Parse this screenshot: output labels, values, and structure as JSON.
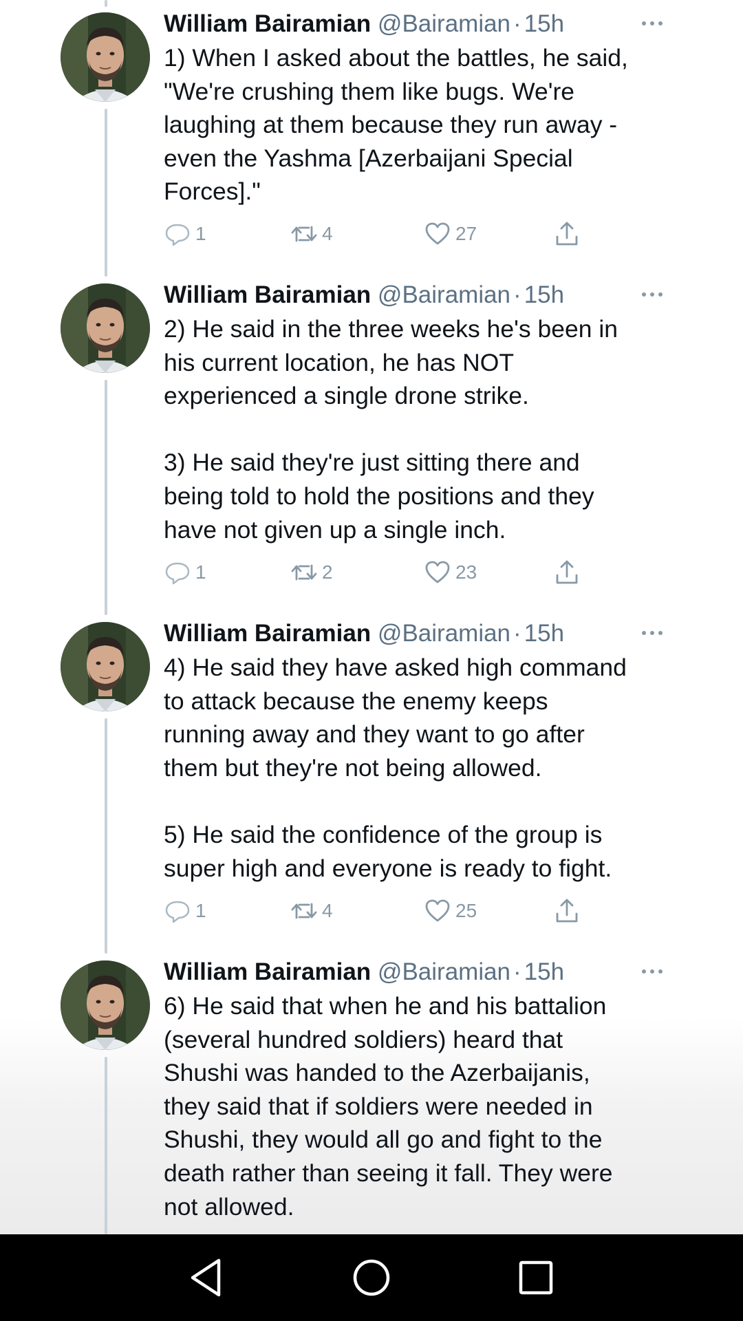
{
  "colors": {
    "text": "#0f1419",
    "secondary": "#5b7083",
    "action_gray": "#8899a6",
    "thread_line": "#c9d1d8",
    "nav_bg": "#000000"
  },
  "tweets": [
    {
      "author": "William Bairamian",
      "handle": "@Bairamian",
      "separator": "·",
      "time": "15h",
      "text": "1) When I asked about the battles, he said,\n\"We're crushing them like bugs. We're\nlaughing at them because they run away -\neven the Yashma [Azerbaijani Special\nForces].\"",
      "replies": "1",
      "retweets": "4",
      "likes": "27"
    },
    {
      "author": "William Bairamian",
      "handle": "@Bairamian",
      "separator": "·",
      "time": "15h",
      "text": "2) He said in the three weeks he's been in\nhis current location, he has NOT\nexperienced a single drone strike.\n\n3) He said they're just sitting there and\nbeing told to hold the positions and they\nhave not given up a single inch.",
      "replies": "1",
      "retweets": "2",
      "likes": "23"
    },
    {
      "author": "William Bairamian",
      "handle": "@Bairamian",
      "separator": "·",
      "time": "15h",
      "text": "4) He said they have asked high command\nto attack because the enemy keeps\nrunning away and they want to go after\nthem but they're not being allowed.\n\n5) He said the confidence of the group is\nsuper high and everyone is ready to fight.",
      "replies": "1",
      "retweets": "4",
      "likes": "25"
    },
    {
      "author": "William Bairamian",
      "handle": "@Bairamian",
      "separator": "·",
      "time": "15h",
      "text": "6) He said that when he and his battalion\n(several hundred soldiers) heard that\nShushi was handed to the Azerbaijanis,\nthey said that if soldiers were needed in\nShushi, they would all go and fight to the\ndeath rather than seeing it fall. They were\nnot allowed."
    }
  ],
  "icons": {
    "more": "more-options-icon",
    "reply": "reply-icon",
    "retweet": "retweet-icon",
    "like": "heart-icon",
    "share": "share-icon",
    "nav_back": "back-triangle-icon",
    "nav_home": "home-circle-icon",
    "nav_recents": "recents-square-icon"
  }
}
